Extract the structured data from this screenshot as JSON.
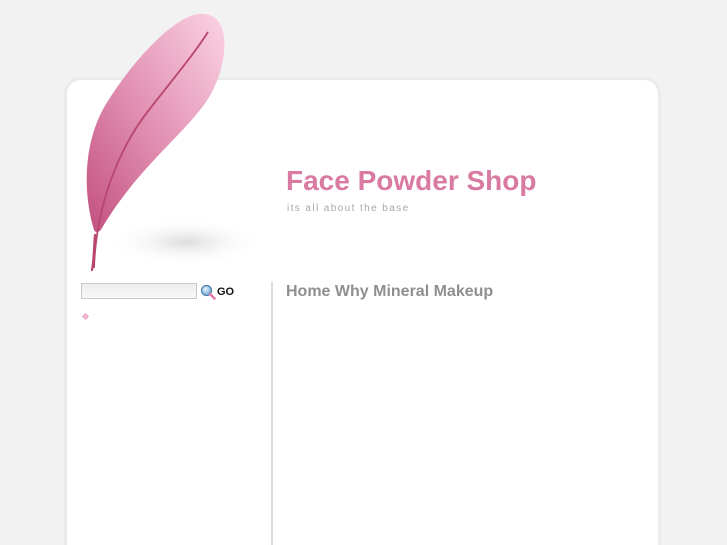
{
  "header": {
    "title": "Face Powder Shop",
    "tagline": "its all about the base"
  },
  "search": {
    "value": "",
    "placeholder": "",
    "button_label": "GO"
  },
  "nav": {
    "items": [
      {
        "label": "Home"
      },
      {
        "label": "Why Mineral Makeup"
      }
    ]
  },
  "colors": {
    "accent": "#d97aa2",
    "nav_text": "#8f8f8f",
    "tagline": "#a8a8a8",
    "background": "#f2f2f2"
  },
  "icons": {
    "logo": "feather-logo",
    "search": "magnifier-icon",
    "bullet": "diamond-bullet-icon"
  }
}
